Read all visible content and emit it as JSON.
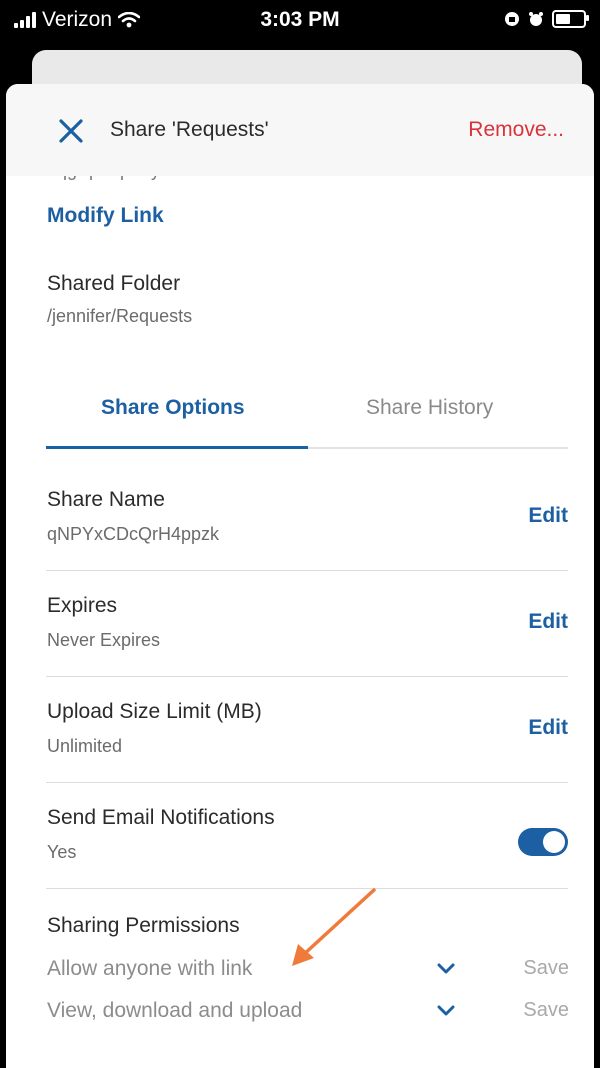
{
  "status": {
    "carrier": "Verizon",
    "time": "3:03 PM"
  },
  "header": {
    "title": "Share 'Requests'",
    "remove_label": "Remove..."
  },
  "link_partial": "bqgrqm-qmrry.nuur",
  "modify_link": "Modify Link",
  "shared_folder": {
    "label": "Shared Folder",
    "path": "/jennifer/Requests"
  },
  "tabs": [
    {
      "label": "Share Options"
    },
    {
      "label": "Share History"
    }
  ],
  "settings": [
    {
      "label": "Share Name",
      "value": "qNPYxCDcQrH4ppzk",
      "action": "Edit"
    },
    {
      "label": "Expires",
      "value": "Never Expires",
      "action": "Edit"
    },
    {
      "label": "Upload Size Limit (MB)",
      "value": "Unlimited",
      "action": "Edit"
    },
    {
      "label": "Send Email Notifications",
      "value": "Yes"
    }
  ],
  "permissions": {
    "title": "Sharing Permissions",
    "items": [
      {
        "label": "Allow anyone with link",
        "save": "Save"
      },
      {
        "label": "View, download and upload",
        "save": "Save"
      }
    ]
  },
  "colors": {
    "accent": "#1d5fa3",
    "danger": "#d9343c",
    "annotation_arrow": "#f07a3a"
  },
  "toggles": {
    "email_notifications_on": true
  }
}
